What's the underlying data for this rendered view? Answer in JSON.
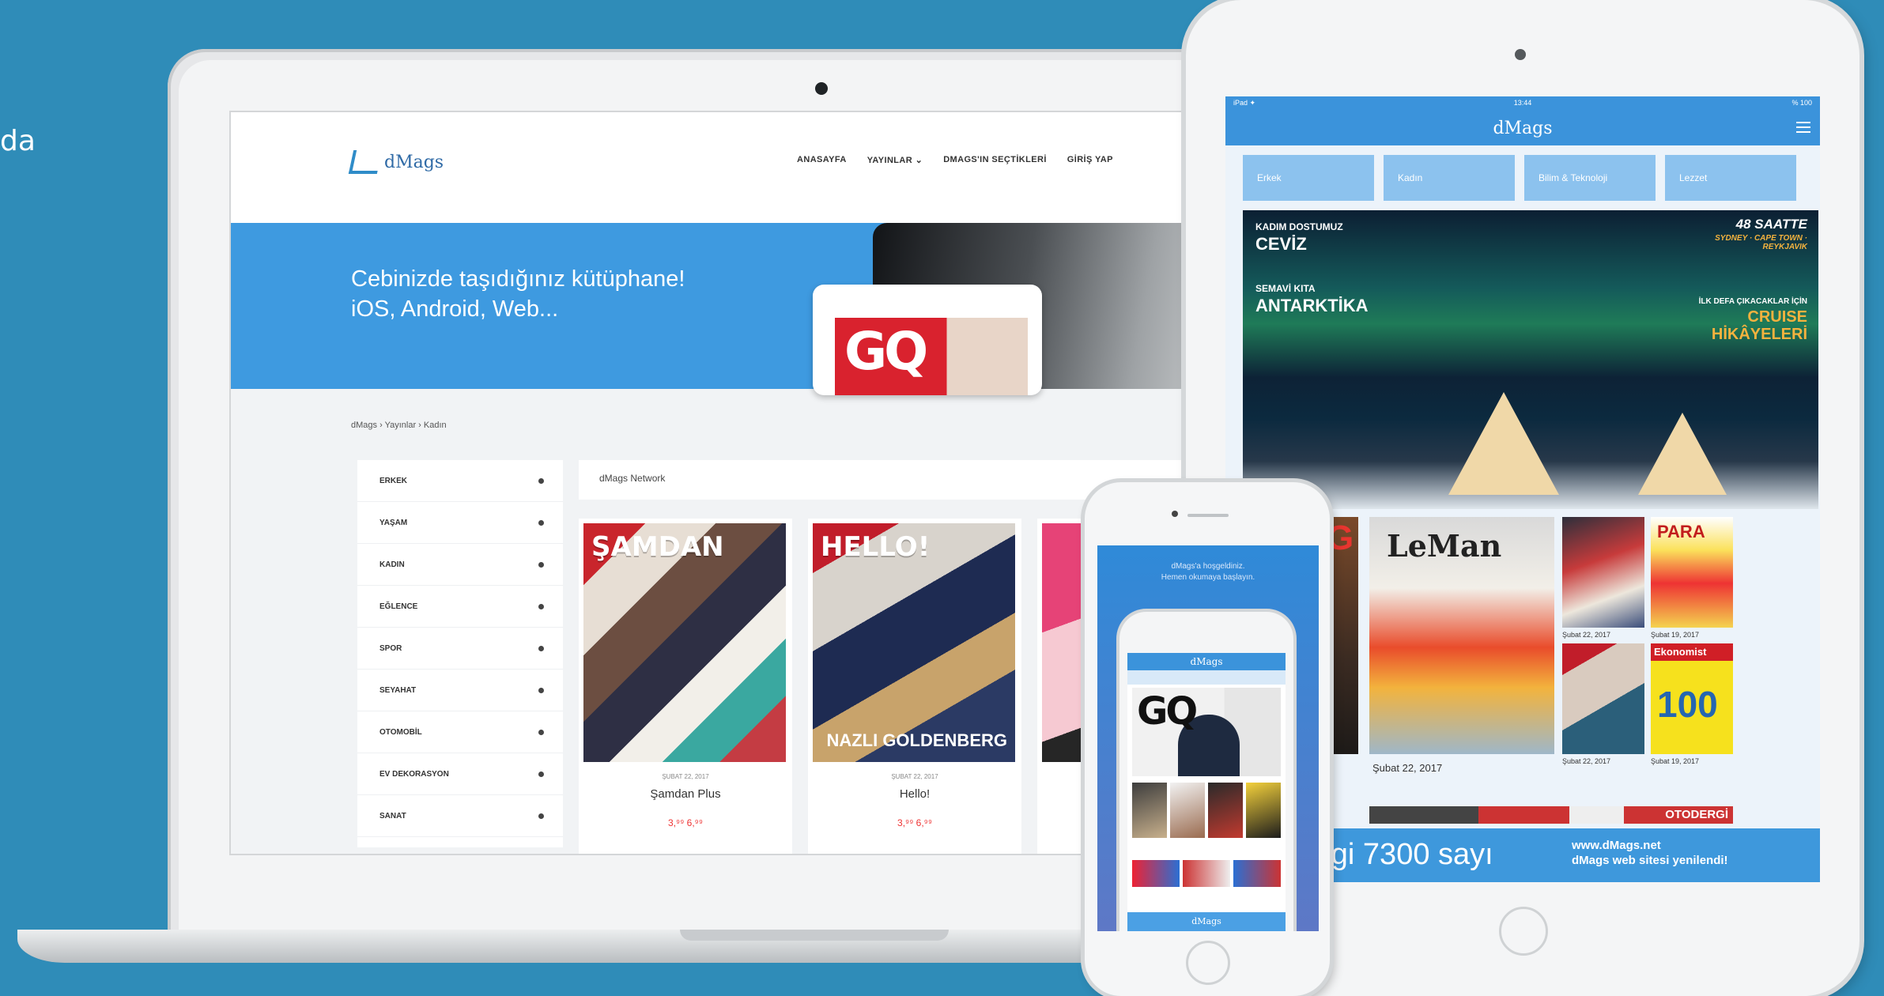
{
  "edge_text": "da",
  "laptop": {
    "logo": "dMags",
    "nav": [
      "ANASAYFA",
      "YAYINLAR ⌄",
      "DMAGS'IN SEÇTİKLERİ",
      "GİRİŞ YAP"
    ],
    "hero_line1": "Cebinizde taşıdığınız kütüphane!",
    "hero_line2": "iOS, Android, Web...",
    "hero_gq": "GQ",
    "breadcrumb": "dMags › Yayınlar › Kadın",
    "categories": [
      "ERKEK",
      "YAŞAM",
      "KADIN",
      "EĞLENCE",
      "SPOR",
      "SEYAHAT",
      "OTOMOBİL",
      "EV DEKORASYON",
      "SANAT"
    ],
    "network_label": "dMags Network",
    "magazines": [
      {
        "brand": "ŞAMDAN",
        "cover_text": "",
        "date": "ŞUBAT 22, 2017",
        "title": "Şamdan Plus",
        "price": "3,⁹⁹ 6,⁹⁹"
      },
      {
        "brand": "HELLO!",
        "cover_text": "NAZLI GOLDENBERG",
        "date": "ŞUBAT 22, 2017",
        "title": "Hello!",
        "price": "3,⁹⁹ 6,⁹⁹"
      },
      {
        "brand": "",
        "cover_text": "",
        "date": "",
        "title": "",
        "price": ""
      }
    ]
  },
  "tablet": {
    "status_left": "iPad ✦",
    "status_time": "13:44",
    "status_right": "% 100",
    "app_title": "dMags",
    "tabs": [
      "Erkek",
      "Kadın",
      "Bilim & Teknoloji",
      "Lezzet"
    ],
    "hero": {
      "l1_small": "KADIM DOSTUMUZ",
      "l1_big": "CEVİZ",
      "l2_small": "SEMAVİ KITA",
      "l2_big": "ANTARKTİKA",
      "r_big": "48 SAATTE",
      "r_cities": "SYDNEY · CAPE TOWN · REYKJAVIK",
      "r_small": "İLK DEFA ÇIKACAKLAR İÇİN",
      "r_cruise": "CRUISE",
      "r_hikaye": "HİKÂYELERİ"
    },
    "grid": {
      "dog_title": "DOG",
      "leman": "LeMan",
      "para": "PARA",
      "ekonomist": "Ekonomist",
      "ekonomist_big": "100",
      "main_date": "Şubat 22, 2017",
      "small_dates": [
        "Şubat 22, 2017",
        "Şubat 19, 2017",
        "Şubat 22, 2017",
        "Şubat 19, 2017"
      ],
      "otoderg": "OTODERGİ"
    },
    "banner_big": "ergi  7300 sayı",
    "banner_url": "www.dMags.net",
    "banner_note": "dMags web sitesi yenilendi!"
  },
  "phone": {
    "text_line1": "dMags'a hoşgeldiniz.",
    "text_line2": "Hemen okumaya başlayın.",
    "inner_title": "dMags",
    "inner_gq": "GQ",
    "inner_footer": "dMags"
  },
  "colors": {
    "background": "#2f8cb8",
    "brand_blue": "#3e9ae0",
    "app_bar": "#3b93db",
    "tab": "#8cc2ee"
  }
}
